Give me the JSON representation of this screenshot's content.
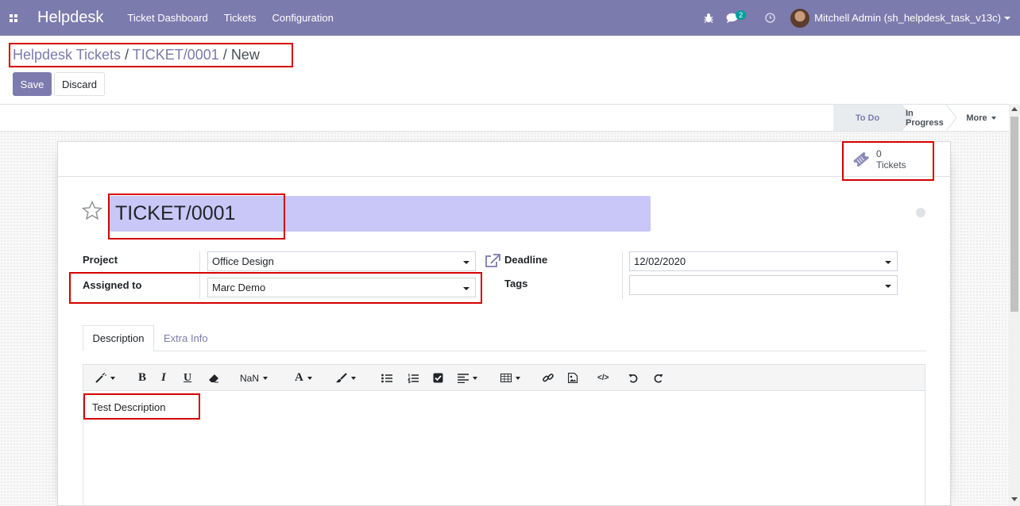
{
  "navbar": {
    "brand": "Helpdesk",
    "menu": [
      "Ticket Dashboard",
      "Tickets",
      "Configuration"
    ],
    "messages_count": "2",
    "user": "Mitchell Admin (sh_helpdesk_task_v13c)"
  },
  "breadcrumb": {
    "root": "Helpdesk Tickets",
    "sep1": " / ",
    "ticket": "TICKET/0001",
    "sep2": " / ",
    "current": "New"
  },
  "buttons": {
    "save": "Save",
    "discard": "Discard"
  },
  "statusbar": {
    "stages": [
      "To Do",
      "In Progress"
    ],
    "active_stage": "To Do",
    "more": "More"
  },
  "smart_button": {
    "count": "0",
    "label": "Tickets"
  },
  "form": {
    "title": "TICKET/0001",
    "project_label": "Project",
    "project_value": "Office Design",
    "assigned_label": "Assigned to",
    "assigned_value": "Marc Demo",
    "deadline_label": "Deadline",
    "deadline_value": "12/02/2020",
    "tags_label": "Tags",
    "tags_value": ""
  },
  "tabs": [
    "Description",
    "Extra Info"
  ],
  "editor": {
    "font_size_label": "NaN",
    "content": "Test Description"
  },
  "colors": {
    "primary": "#7c7bad",
    "title_bg": "#c8c7f7",
    "highlight": "#d60000",
    "badge": "#00a09d"
  }
}
